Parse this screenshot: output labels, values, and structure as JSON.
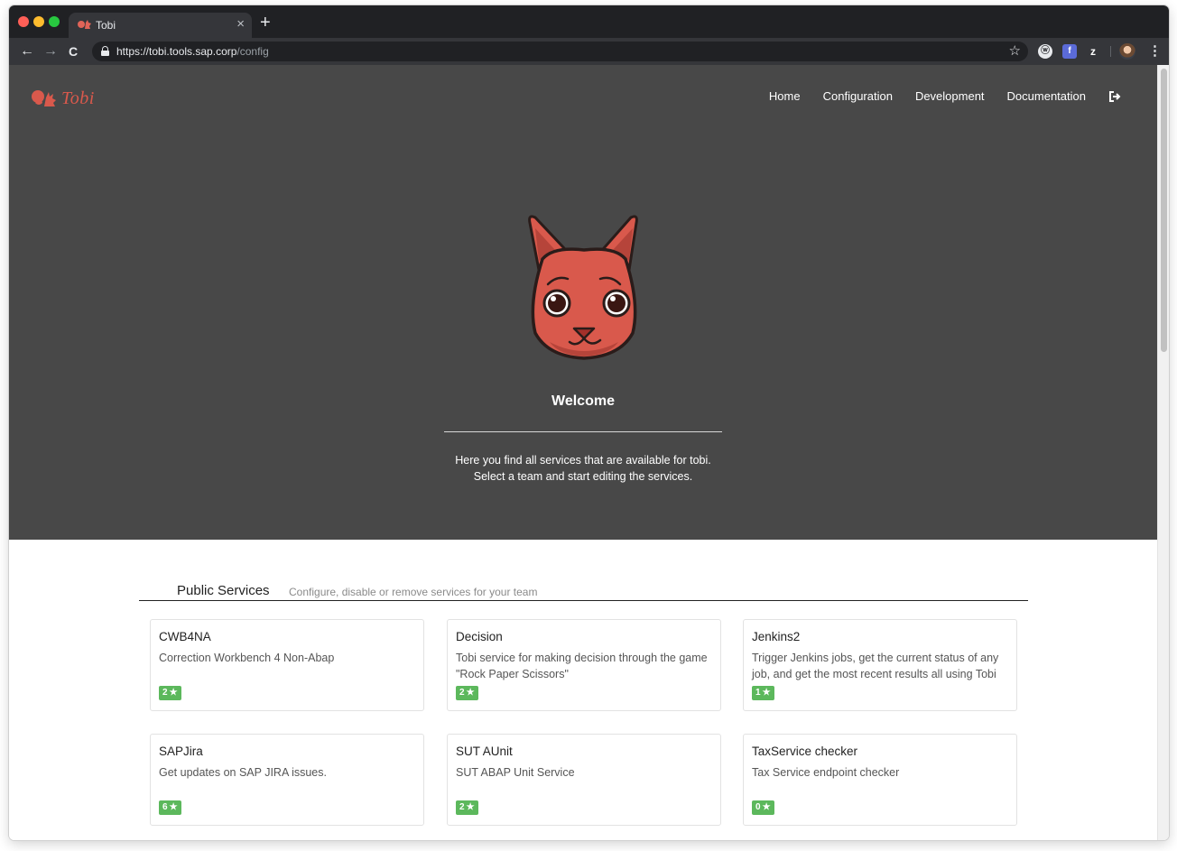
{
  "browser": {
    "tab_title": "Tobi",
    "tab_close": "×",
    "new_tab": "+",
    "url_host": "https://tobi.tools.sap.corp",
    "url_path": "/config",
    "back": "←",
    "forward": "→",
    "reload": "C",
    "bookmark_star": "☆",
    "menu": "⋮",
    "extensions": [
      "ⓦ",
      "f",
      "z"
    ]
  },
  "app": {
    "logo_text": "Tobi",
    "nav": [
      "Home",
      "Configuration",
      "Development",
      "Documentation"
    ],
    "hero_title": "Welcome",
    "hero_line1": "Here you find all services that are available for tobi.",
    "hero_line2": "Select a team and start editing the services."
  },
  "services": {
    "title": "Public Services",
    "subtitle": "Configure, disable or remove services for your team",
    "star": "★",
    "cards": [
      {
        "name": "CWB4NA",
        "desc": "Correction Workbench 4 Non-Abap",
        "stars": "2"
      },
      {
        "name": "Decision",
        "desc": "Tobi service for making decision through the game \"Rock Paper Scissors\"",
        "stars": "2"
      },
      {
        "name": "Jenkins2",
        "desc": "Trigger Jenkins jobs, get the current status of any job, and get the most recent results all using Tobi",
        "stars": "1"
      },
      {
        "name": "SAPJira",
        "desc": "Get updates on SAP JIRA issues.",
        "stars": "6"
      },
      {
        "name": "SUT AUnit",
        "desc": "SUT ABAP Unit Service",
        "stars": "2"
      },
      {
        "name": "TaxService checker",
        "desc": "Tax Service endpoint checker",
        "stars": "0"
      }
    ]
  },
  "colors": {
    "hero_bg": "#484848",
    "accent": "#d9594c",
    "badge": "#5cb85c"
  }
}
